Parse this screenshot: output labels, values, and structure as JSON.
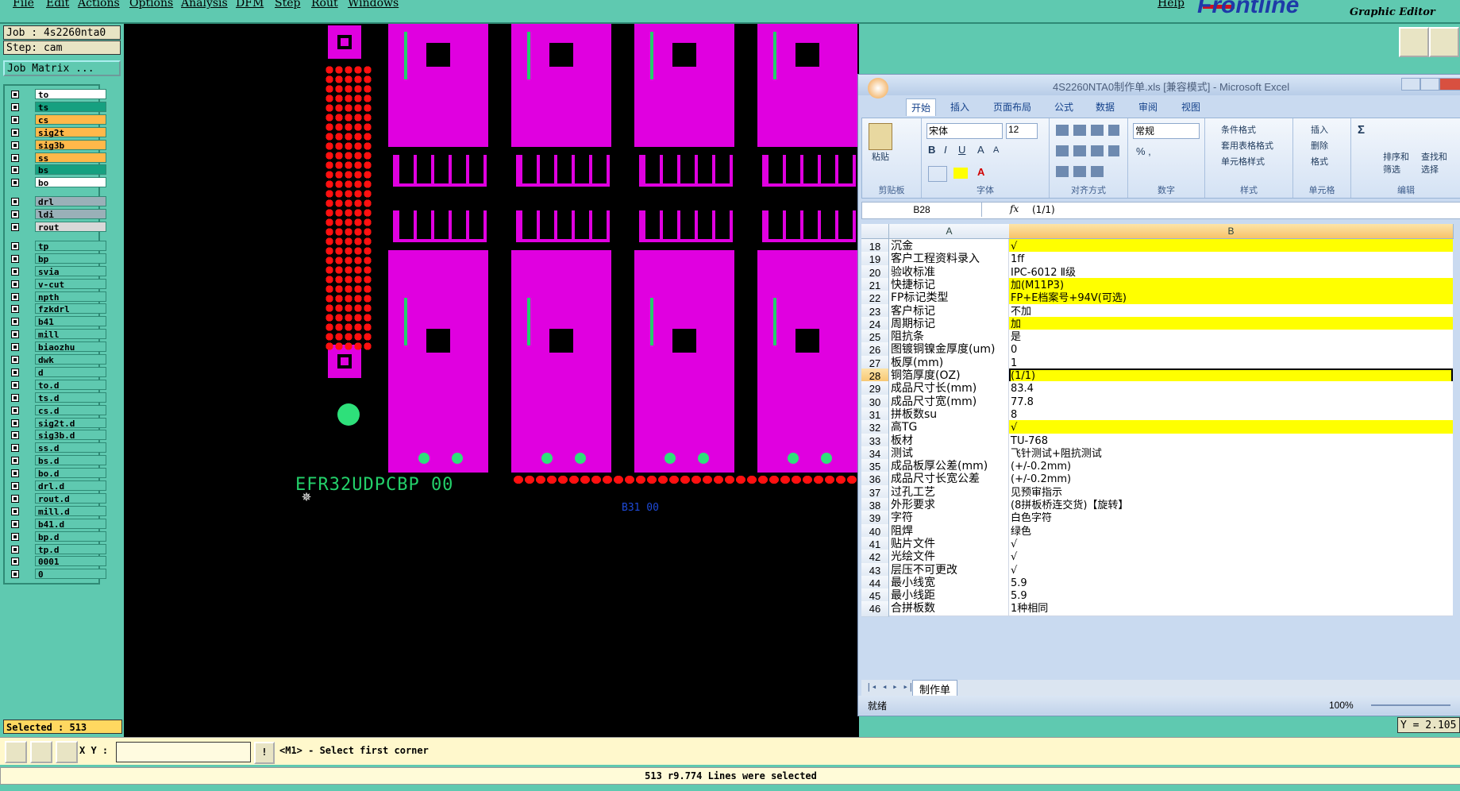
{
  "menu": {
    "items": [
      "File",
      "Edit",
      "Actions",
      "Options",
      "Analysis",
      "DFM",
      "Step",
      "Rout",
      "Windows"
    ],
    "help": "Help",
    "brand": "Frontline",
    "subtitle": "Graphic Editor"
  },
  "job": {
    "job_label": "Job : 4s2260nta0",
    "step_label": "Step: cam",
    "matrix_button": "Job Matrix ..."
  },
  "layers": [
    {
      "name": "to",
      "color": "#ffffff"
    },
    {
      "name": "ts",
      "color": "#16a080"
    },
    {
      "name": "cs",
      "color": "#ffb84a"
    },
    {
      "name": "sig2t",
      "color": "#ffb84a"
    },
    {
      "name": "sig3b",
      "color": "#ffb84a"
    },
    {
      "name": "ss",
      "color": "#ffb84a"
    },
    {
      "name": "bs",
      "color": "#16a080"
    },
    {
      "name": "bo",
      "color": "#ffffff"
    },
    {
      "name": "drl",
      "color": "#9ab0b8"
    },
    {
      "name": "ldi",
      "color": "#9ab0b8"
    },
    {
      "name": "rout",
      "color": "#d8d8d8"
    },
    {
      "name": "tp",
      "color": "#5fc9b0"
    },
    {
      "name": "bp",
      "color": "#5fc9b0"
    },
    {
      "name": "svia",
      "color": "#5fc9b0"
    },
    {
      "name": "v-cut",
      "color": "#5fc9b0"
    },
    {
      "name": "npth",
      "color": "#5fc9b0"
    },
    {
      "name": "fzkdrl",
      "color": "#5fc9b0"
    },
    {
      "name": "b41",
      "color": "#5fc9b0"
    },
    {
      "name": "mill",
      "color": "#5fc9b0"
    },
    {
      "name": "biaozhu",
      "color": "#5fc9b0"
    },
    {
      "name": "dwk",
      "color": "#5fc9b0"
    },
    {
      "name": "d",
      "color": "#5fc9b0"
    },
    {
      "name": "to.d",
      "color": "#5fc9b0"
    },
    {
      "name": "ts.d",
      "color": "#5fc9b0"
    },
    {
      "name": "cs.d",
      "color": "#5fc9b0"
    },
    {
      "name": "sig2t.d",
      "color": "#5fc9b0"
    },
    {
      "name": "sig3b.d",
      "color": "#5fc9b0"
    },
    {
      "name": "ss.d",
      "color": "#5fc9b0"
    },
    {
      "name": "bs.d",
      "color": "#5fc9b0"
    },
    {
      "name": "bo.d",
      "color": "#5fc9b0"
    },
    {
      "name": "drl.d",
      "color": "#5fc9b0"
    },
    {
      "name": "rout.d",
      "color": "#5fc9b0"
    },
    {
      "name": "mill.d",
      "color": "#5fc9b0"
    },
    {
      "name": "b41.d",
      "color": "#5fc9b0"
    },
    {
      "name": "bp.d",
      "color": "#5fc9b0"
    },
    {
      "name": "tp.d",
      "color": "#5fc9b0"
    },
    {
      "name": "0001",
      "color": "#5fc9b0"
    },
    {
      "name": "0",
      "color": "#5fc9b0"
    }
  ],
  "canvas": {
    "board_label": "EFR32UDPCBP 00",
    "small_label": "B31 00"
  },
  "excel": {
    "title": "4S2260NTA0制作单.xls [兼容模式] - Microsoft Excel",
    "tabs": [
      "开始",
      "插入",
      "页面布局",
      "公式",
      "数据",
      "审阅",
      "视图"
    ],
    "groups": {
      "clipboard": "剪贴板",
      "font": "字体",
      "align": "对齐方式",
      "number": "数字",
      "styles": "样式",
      "cells": "单元格",
      "edit": "编辑"
    },
    "font_name": "宋体",
    "font_size": "12",
    "number_format": "常规",
    "paste": "粘贴",
    "cond_format": "条件格式",
    "table_format": "套用表格格式",
    "cell_style": "单元格样式",
    "insert": "插入",
    "delete": "删除",
    "format": "格式",
    "sort": "排序和\n筛选",
    "find": "查找和\n选择",
    "name_box": "B28",
    "formula_value": "(1/1)",
    "col_a": "A",
    "col_b": "B",
    "rows": [
      {
        "n": "18",
        "a": "沉金",
        "b": "√",
        "hl": true
      },
      {
        "n": "19",
        "a": "客户工程资料录入",
        "b": "1ff",
        "hl": false
      },
      {
        "n": "20",
        "a": "验收标准",
        "b": "IPC-6012 Ⅱ级",
        "hl": false
      },
      {
        "n": "21",
        "a": "快捷标记",
        "b": "加(M11P3)",
        "hl": true
      },
      {
        "n": "22",
        "a": "FP标记类型",
        "b": "FP+E档案号+94V(可选)",
        "hl": true
      },
      {
        "n": "23",
        "a": "客户标记",
        "b": "不加",
        "hl": false
      },
      {
        "n": "24",
        "a": "周期标记",
        "b": "加",
        "hl": true
      },
      {
        "n": "25",
        "a": "阻抗条",
        "b": "是",
        "hl": false
      },
      {
        "n": "26",
        "a": "图镀铜镍金厚度(um)",
        "b": "0",
        "hl": false
      },
      {
        "n": "27",
        "a": "板厚(mm)",
        "b": "1",
        "hl": false
      },
      {
        "n": "28",
        "a": "铜箔厚度(OZ)",
        "b": " (1/1)",
        "hl": true
      },
      {
        "n": "29",
        "a": "成品尺寸长(mm)",
        "b": "83.4",
        "hl": false
      },
      {
        "n": "30",
        "a": "成品尺寸宽(mm)",
        "b": "77.8",
        "hl": false
      },
      {
        "n": "31",
        "a": "拼板数su",
        "b": "8",
        "hl": false
      },
      {
        "n": "32",
        "a": "高TG",
        "b": "√",
        "hl": true
      },
      {
        "n": "33",
        "a": "板材",
        "b": "TU-768",
        "hl": false
      },
      {
        "n": "34",
        "a": "测试",
        "b": "飞针测试+阻抗测试",
        "hl": false
      },
      {
        "n": "35",
        "a": "成品板厚公差(mm)",
        "b": "(+/-0.2mm)",
        "hl": false
      },
      {
        "n": "36",
        "a": "成品尺寸长宽公差",
        "b": "(+/-0.2mm)",
        "hl": false
      },
      {
        "n": "37",
        "a": "过孔工艺",
        "b": "见预审指示",
        "hl": false
      },
      {
        "n": "38",
        "a": "外形要求",
        "b": "(8拼板桥连交货)【旋转】",
        "hl": false
      },
      {
        "n": "39",
        "a": "字符",
        "b": "白色字符",
        "hl": false
      },
      {
        "n": "40",
        "a": "阻焊",
        "b": "绿色",
        "hl": false
      },
      {
        "n": "41",
        "a": "贴片文件",
        "b": "√",
        "hl": false
      },
      {
        "n": "42",
        "a": "光绘文件",
        "b": "√",
        "hl": false
      },
      {
        "n": "43",
        "a": "层压不可更改",
        "b": "√",
        "hl": false
      },
      {
        "n": "44",
        "a": "最小线宽",
        "b": "5.9",
        "hl": false
      },
      {
        "n": "45",
        "a": "最小线距",
        "b": "5.9",
        "hl": false
      },
      {
        "n": "46",
        "a": "合拼板数",
        "b": "1种相同",
        "hl": false
      }
    ],
    "sheet_tab": "制作单",
    "status_ready": "就绪",
    "zoom": "100%"
  },
  "status": {
    "selected": "Selected : 513",
    "xy_label": "X Y :",
    "prompt": "<M1> - Select first corner",
    "message": "513 r9.774 Lines were selected",
    "coord_readout": "Y = 2.105"
  }
}
